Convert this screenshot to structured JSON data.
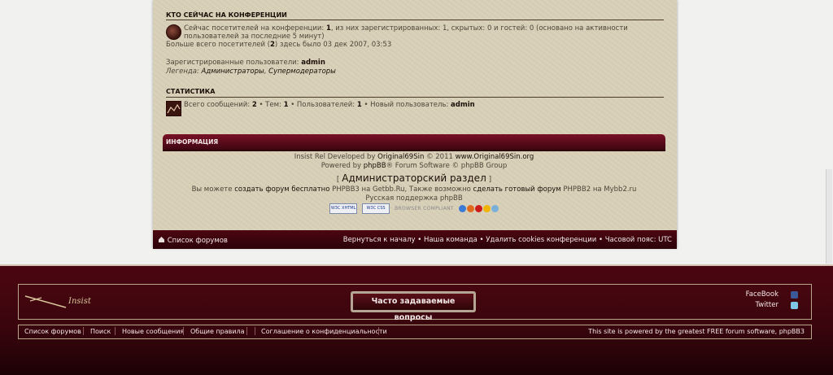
{
  "online": {
    "title": "КТО СЕЙЧАС НА КОНФЕРЕНЦИИ",
    "line1_a": "Сейчас посетителей на конференции: ",
    "total": "1",
    "line1_b": ", из них зарегистрированных: 1, скрытых: 0 и гостей: 0 (основано на активности",
    "line2": "пользователей за последние 5 минут)",
    "record_a": "Больше всего посетителей (",
    "record_num": "2",
    "record_b": ") здесь было 03 дек 2007, 03:53",
    "registered_label": "Зарегистрированные пользователи: ",
    "registered_user": "admin",
    "legend_label": "Легенда: ",
    "legend_admins": "Администраторы",
    "legend_sep": ", ",
    "legend_supermods": "Супермодераторы"
  },
  "stats": {
    "title": "СТАТИСТИКА",
    "posts_label": "Всего сообщений: ",
    "posts": "2",
    "topics_label": " • Тем: ",
    "topics": "1",
    "users_label": " • Пользователей: ",
    "users": "1",
    "newuser_label": " • Новый пользователь: ",
    "newuser": "admin"
  },
  "info": {
    "title": "ИНФОРМАЦИЯ",
    "line1_a": "Insist Rel Developed by ",
    "line1_author": "Original69Sin",
    "line1_b": " © 2011 ",
    "line1_site": "www.Original69Sin.org",
    "line2_a": "Powered by ",
    "line2_phpbb": "phpBB",
    "line2_b": "® Forum Software © phpBB Group",
    "admin_open": "[ ",
    "admin_link": "Администраторский раздел",
    "admin_close": " ]",
    "line4_a": "Вы можете ",
    "line4_create": "создать форум бесплатно",
    "line4_b": " PHPBB3 на Getbb.Ru, Также возможно ",
    "line4_ready": "сделать готовый форум",
    "line4_c": " PHPBB2 на Mybb2.ru",
    "support": "Русская поддержка phpBB",
    "badge_xhtml": "W3C XHTML",
    "badge_css": "W3C CSS",
    "browser_compliant": "BROWSER COMPLIANT"
  },
  "navbar": {
    "home": "Список форумов",
    "right": "Вернуться к началу • Наша команда • Удалить cookies конференции • Часовой пояс: UTC"
  },
  "footer": {
    "faq": "Часто задаваемые вопросы",
    "facebook": "FaceBook",
    "twitter": "Twitter",
    "links": [
      "Список форумов",
      "Поиск",
      "Новые сообщения",
      "Общие правила",
      "Соглашение о конфиденциальности"
    ],
    "powered": "This site is powered by the greatest FREE forum software, phpBB3",
    "logo_text": "Insist"
  }
}
